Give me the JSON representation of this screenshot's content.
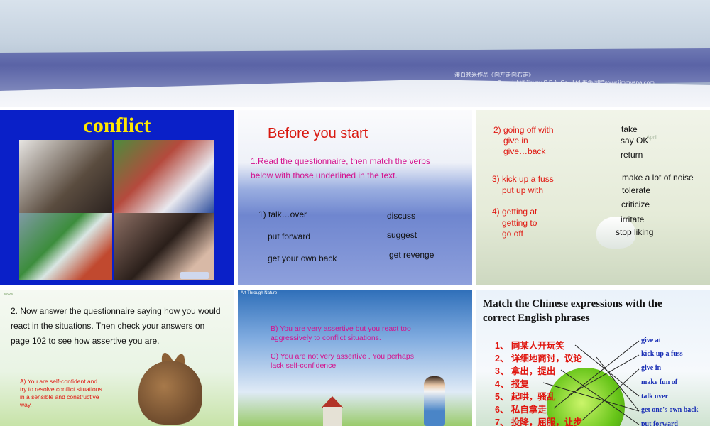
{
  "top_slide": {
    "credit_line1": "澳白映米作品《向左走向右走》",
    "credit_line2": "Copyright©Jimmy S.P.A. Co., Ltd 墨色国際www.jimmyspa.com"
  },
  "slide1": {
    "title": "conflict"
  },
  "slide2": {
    "title": "Before you start",
    "instruction": "1.Read the questionnaire, then match the verbs below with those underlined in the text.",
    "left_items": [
      "1) talk…over",
      "put forward",
      "get your own back"
    ],
    "right_items": [
      "discuss",
      "suggest",
      "get revenge"
    ]
  },
  "slide3": {
    "groups": [
      {
        "lines": [
          "2) going off with",
          "give in",
          "give…back"
        ]
      },
      {
        "lines": [
          "3) kick up a fuss",
          "put up with"
        ]
      },
      {
        "lines": [
          "4) getting at",
          "getting to",
          "go off"
        ]
      }
    ],
    "answers": [
      "take",
      "say OK",
      "return",
      "make a lot of noise",
      "tolerate",
      "criticize",
      "irritate",
      "stop liking"
    ],
    "calendar_label": "April"
  },
  "slide4": {
    "text": "2. Now answer the questionnaire saying how you would react in the situations. Then check your answers on page 102 to see how assertive you are.",
    "option_a": "A) You are self-confident and try to resolve conflict situations in a sensible and constructive way."
  },
  "slide5": {
    "header": "Art Through Nature",
    "option_b": "B) You are very assertive but you react too aggressively to conflict situations.",
    "option_c": "C) You are not very assertive . You perhaps lack self-confidence"
  },
  "slide6": {
    "title": "Match the Chinese expressions with the correct English phrases",
    "chinese": [
      "1、 同某人开玩笑",
      "2、 详细地商讨，议论",
      "3、 拿出，提出",
      "4、 报复",
      "5、 起哄，骚乱",
      "6、 私自拿走",
      "7、 投降，屈服，让步"
    ],
    "english": [
      "give at",
      "kick up a fuss",
      "give in",
      "make fun of",
      "talk over",
      "get one's own back",
      "put forward"
    ]
  }
}
